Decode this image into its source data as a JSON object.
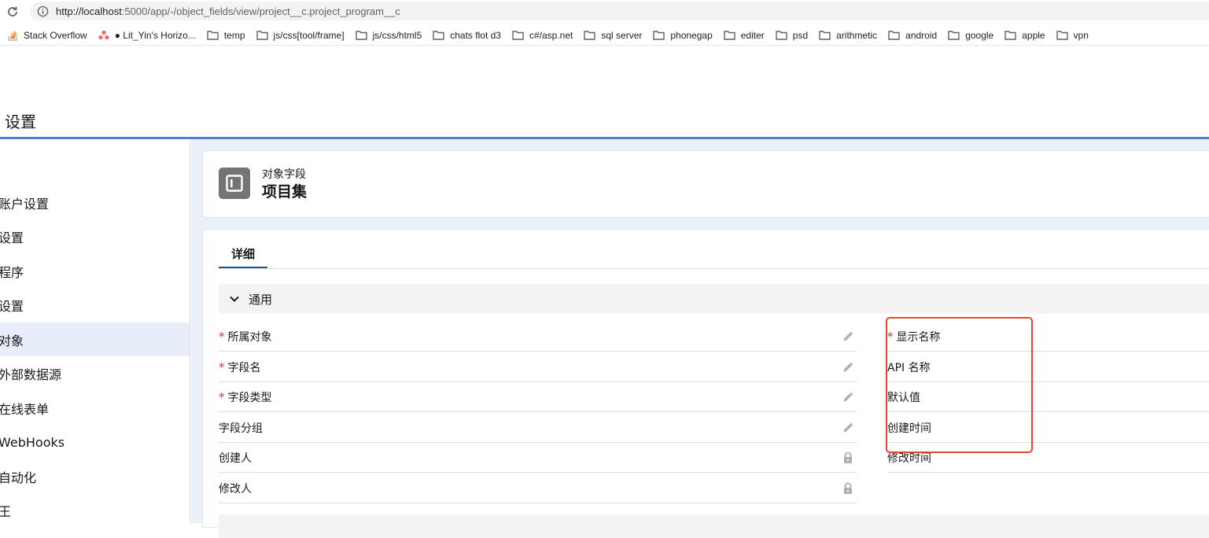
{
  "browser": {
    "url_host": "http://localhost",
    "url_rest": ":5000/app/-/object_fields/view/project__c.project_program__c",
    "bookmarks": [
      {
        "label": "Stack Overflow",
        "icon": "stackoverflow-icon"
      },
      {
        "label": "● Lit_Yin's Horizo...",
        "icon": "asana-icon"
      },
      {
        "label": "temp",
        "icon": "folder-icon"
      },
      {
        "label": "js/css[tool/frame]",
        "icon": "folder-icon"
      },
      {
        "label": "js/css/html5",
        "icon": "folder-icon"
      },
      {
        "label": "chats flot d3",
        "icon": "folder-icon"
      },
      {
        "label": "c#/asp.net",
        "icon": "folder-icon"
      },
      {
        "label": "sql server",
        "icon": "folder-icon"
      },
      {
        "label": "phonegap",
        "icon": "folder-icon"
      },
      {
        "label": "editer",
        "icon": "folder-icon"
      },
      {
        "label": "psd",
        "icon": "folder-icon"
      },
      {
        "label": "arithmetic",
        "icon": "folder-icon"
      },
      {
        "label": "android",
        "icon": "folder-icon"
      },
      {
        "label": "google",
        "icon": "folder-icon"
      },
      {
        "label": "apple",
        "icon": "folder-icon"
      },
      {
        "label": "vpn",
        "icon": "folder-icon"
      }
    ]
  },
  "app": {
    "title": "设置"
  },
  "sidebar": {
    "items": [
      {
        "label": "账户设置",
        "active": false
      },
      {
        "label": "设置",
        "active": false
      },
      {
        "label": "程序",
        "active": false
      },
      {
        "label": "设置",
        "active": false
      },
      {
        "label": "对象",
        "active": true
      },
      {
        "label": "外部数据源",
        "active": false
      },
      {
        "label": "在线表单",
        "active": false
      },
      {
        "label": "WebHooks",
        "active": false
      },
      {
        "label": "自动化",
        "active": false
      },
      {
        "label": "王",
        "active": false
      }
    ]
  },
  "header": {
    "subtitle": "对象字段",
    "title": "项目集"
  },
  "tabs": {
    "detail": "详细"
  },
  "section": {
    "general": "通用"
  },
  "fields_left": [
    {
      "label": "所属对象",
      "required": true,
      "action": "pencil-icon"
    },
    {
      "label": "字段名",
      "required": true,
      "action": "pencil-icon"
    },
    {
      "label": "字段类型",
      "required": true,
      "action": "pencil-icon"
    },
    {
      "label": "字段分组",
      "required": false,
      "action": "pencil-icon"
    },
    {
      "label": "创建人",
      "required": false,
      "action": "lock-icon"
    },
    {
      "label": "修改人",
      "required": false,
      "action": "lock-icon"
    }
  ],
  "fields_right": [
    {
      "label": "显示名称",
      "required": true
    },
    {
      "label": "API 名称",
      "required": false
    },
    {
      "label": "默认值",
      "required": false
    },
    {
      "label": "创建时间",
      "required": false
    },
    {
      "label": "修改时间",
      "required": false
    }
  ],
  "colors": {
    "accent": "#0b5cab",
    "highlight": "#e5462e",
    "required": "#c23934"
  }
}
